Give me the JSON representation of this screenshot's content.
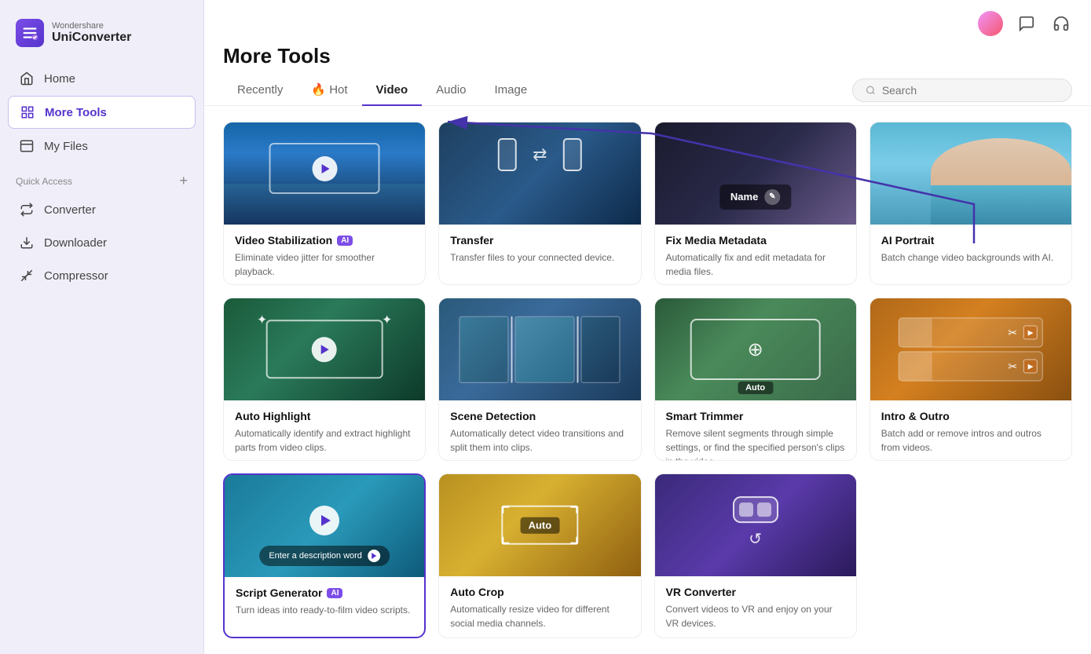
{
  "app": {
    "name": "UniConverter",
    "brand": "Wondershare"
  },
  "sidebar": {
    "nav_items": [
      {
        "id": "home",
        "label": "Home",
        "active": false
      },
      {
        "id": "more-tools",
        "label": "More Tools",
        "active": true
      },
      {
        "id": "my-files",
        "label": "My Files",
        "active": false
      }
    ],
    "section_label": "Quick Access",
    "quick_access": [
      {
        "id": "converter",
        "label": "Converter"
      },
      {
        "id": "downloader",
        "label": "Downloader"
      },
      {
        "id": "compressor",
        "label": "Compressor"
      }
    ]
  },
  "page": {
    "title": "More Tools"
  },
  "tabs": [
    {
      "id": "recently",
      "label": "Recently",
      "active": false
    },
    {
      "id": "hot",
      "label": "🔥 Hot",
      "active": false
    },
    {
      "id": "video",
      "label": "Video",
      "active": true
    },
    {
      "id": "audio",
      "label": "Audio",
      "active": false
    },
    {
      "id": "image",
      "label": "Image",
      "active": false
    }
  ],
  "search": {
    "placeholder": "Search"
  },
  "tools": [
    {
      "id": "video-stabilization",
      "name": "Video Stabilization",
      "ai": true,
      "description": "Eliminate video jitter for smoother playback.",
      "thumb_type": "stabilization"
    },
    {
      "id": "transfer",
      "name": "Transfer",
      "ai": false,
      "description": "Transfer files to your connected device.",
      "thumb_type": "transfer"
    },
    {
      "id": "fix-media-metadata",
      "name": "Fix Media Metadata",
      "ai": false,
      "description": "Automatically fix and edit metadata for media files.",
      "thumb_type": "metadata"
    },
    {
      "id": "ai-portrait",
      "name": "AI Portrait",
      "ai": false,
      "description": "Batch change video backgrounds with AI.",
      "thumb_type": "portrait"
    },
    {
      "id": "auto-highlight",
      "name": "Auto Highlight",
      "ai": false,
      "description": "Automatically identify and extract highlight parts from video clips.",
      "thumb_type": "highlight"
    },
    {
      "id": "scene-detection",
      "name": "Scene Detection",
      "ai": false,
      "description": "Automatically detect video transitions and split them into clips.",
      "thumb_type": "scene"
    },
    {
      "id": "smart-trimmer",
      "name": "Smart Trimmer",
      "ai": false,
      "description": "Remove silent segments through simple settings, or find the specified person's clips in the video.",
      "thumb_type": "trimmer"
    },
    {
      "id": "intro-outro",
      "name": "Intro & Outro",
      "ai": false,
      "description": "Batch add or remove intros and outros from videos.",
      "thumb_type": "intro"
    },
    {
      "id": "script-generator",
      "name": "Script Generator",
      "ai": true,
      "description": "Turn ideas into ready-to-film video scripts.",
      "thumb_type": "script",
      "selected": true
    },
    {
      "id": "auto-crop",
      "name": "Auto Crop",
      "ai": false,
      "description": "Automatically resize video for different social media channels.",
      "thumb_type": "crop"
    },
    {
      "id": "vr-converter",
      "name": "VR Converter",
      "ai": false,
      "description": "Convert videos to VR and enjoy on your VR devices.",
      "thumb_type": "vr"
    }
  ]
}
